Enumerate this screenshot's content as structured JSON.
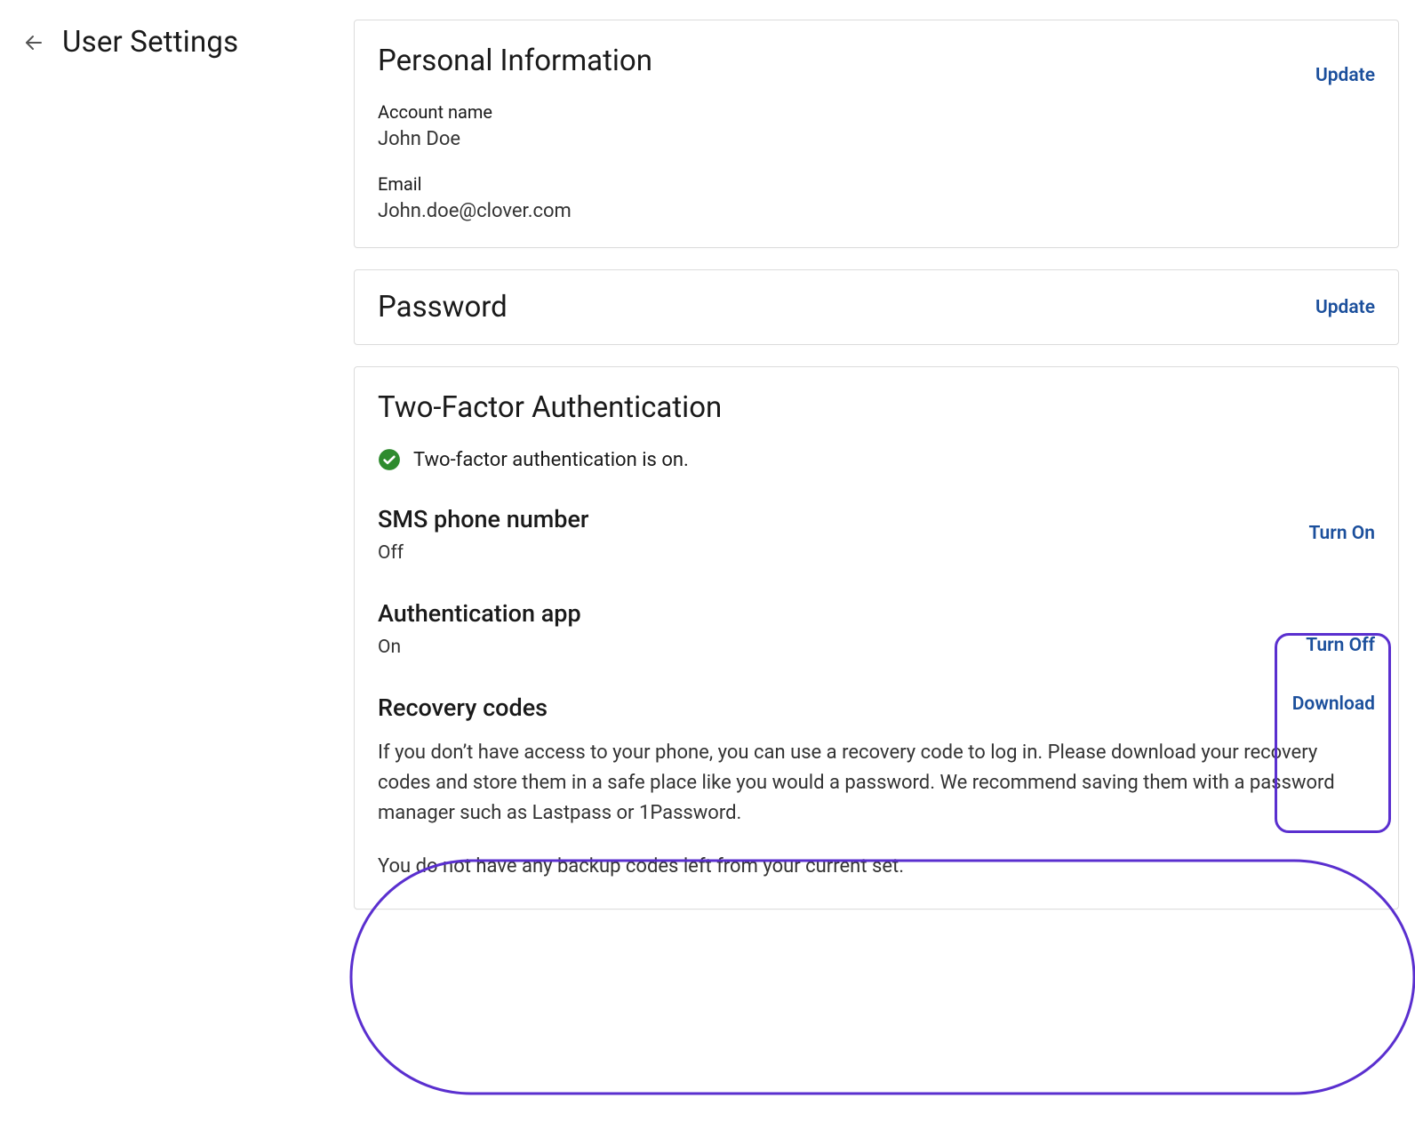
{
  "page": {
    "title": "User Settings"
  },
  "personal": {
    "heading": "Personal Information",
    "account_name_label": "Account name",
    "account_name_value": "John Doe",
    "email_label": "Email",
    "email_value": "John.doe@clover.com",
    "update_label": "Update"
  },
  "password": {
    "heading": "Password",
    "update_label": "Update"
  },
  "tfa": {
    "heading": "Two-Factor Authentication",
    "status_text": "Two-factor authentication is on.",
    "sms": {
      "title": "SMS phone number",
      "value": "Off",
      "action": "Turn On"
    },
    "app": {
      "title": "Authentication app",
      "value": "On",
      "action": "Turn Off"
    },
    "recovery": {
      "title": "Recovery codes",
      "action": "Download",
      "desc1": "If you don’t have access to your phone, you can use a recovery code to log in. Please download your recovery codes and store them in a safe place like you would a password. We recommend saving them with a password manager such as Lastpass or 1Password.",
      "desc2": "You do not have any backup codes left from your current set."
    }
  }
}
